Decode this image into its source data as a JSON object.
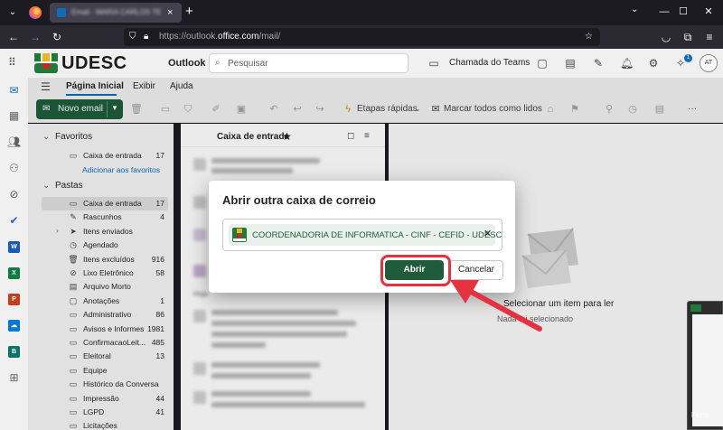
{
  "browser": {
    "tab_title": "Email - MARIA CARLOS TESTE",
    "tab_close": "×",
    "new_tab": "+",
    "url_prefix": "https://outlook.",
    "url_domain": "office.com",
    "url_path": "/mail/",
    "window_min": "—",
    "window_max": "☐",
    "window_close": "✕"
  },
  "header": {
    "logo_text": "UDESC",
    "app_name": "Outlook",
    "search_placeholder": "Pesquisar",
    "teams_label": "Chamada do Teams",
    "notification_count": "1",
    "avatar_initials": "AT"
  },
  "ribbon": {
    "tabs": [
      "Página Inicial",
      "Exibir",
      "Ajuda"
    ],
    "new_mail": "Novo email",
    "quick_steps": "Etapas rápidas",
    "mark_all_read": "Marcar todos como lidos",
    "more": "···"
  },
  "folders": {
    "favorites_title": "Favoritos",
    "favorites": [
      {
        "label": "Caixa de entrada",
        "count": "17"
      }
    ],
    "add_favorites": "Adicionar aos favoritos",
    "pastas_title": "Pastas",
    "items": [
      {
        "label": "Caixa de entrada",
        "count": "17",
        "icon": "inbox-icon"
      },
      {
        "label": "Rascunhos",
        "count": "4",
        "icon": "draft-icon"
      },
      {
        "label": "Itens enviados",
        "count": "",
        "icon": "sent-icon"
      },
      {
        "label": "Agendado",
        "count": "",
        "icon": "clock-icon"
      },
      {
        "label": "Itens excluídos",
        "count": "916",
        "icon": "trash-icon"
      },
      {
        "label": "Lixo Eletrônico",
        "count": "58",
        "icon": "junk-icon"
      },
      {
        "label": "Arquivo Morto",
        "count": "",
        "icon": "archive-icon"
      },
      {
        "label": "Anotações",
        "count": "1",
        "icon": "notes-icon"
      },
      {
        "label": "Administrativo",
        "count": "86",
        "icon": "folder-icon"
      },
      {
        "label": "Avisos e Informes",
        "count": "1981",
        "icon": "folder-icon"
      },
      {
        "label": "ConfirmacaoLeit...",
        "count": "485",
        "icon": "folder-icon"
      },
      {
        "label": "Eleitoral",
        "count": "13",
        "icon": "folder-icon"
      },
      {
        "label": "Equipe",
        "count": "",
        "icon": "folder-icon"
      },
      {
        "label": "Histórico da Conversa",
        "count": "",
        "icon": "folder-icon"
      },
      {
        "label": "Impressão",
        "count": "44",
        "icon": "folder-icon"
      },
      {
        "label": "LGPD",
        "count": "41",
        "icon": "folder-icon"
      },
      {
        "label": "Licitações",
        "count": "",
        "icon": "folder-icon"
      }
    ]
  },
  "message_list": {
    "title": "Caixa de entrada",
    "section_label": "Hoje"
  },
  "reading_pane": {
    "title": "Selecionar um item para ler",
    "subtitle": "Nada foi selecionado"
  },
  "dialog": {
    "title": "Abrir outra caixa de correio",
    "mailbox": "COORDENADORIA DE INFORMATICA - CINF - CEFID - UDESC",
    "remove": "✕",
    "open_button": "Abrir",
    "cancel_button": "Cancelar"
  },
  "taskbar": {
    "caption": "Ferra"
  },
  "colors": {
    "accent_green": "#1f5c3b",
    "highlight_red": "#e53240",
    "link_blue": "#0f6cbd"
  }
}
